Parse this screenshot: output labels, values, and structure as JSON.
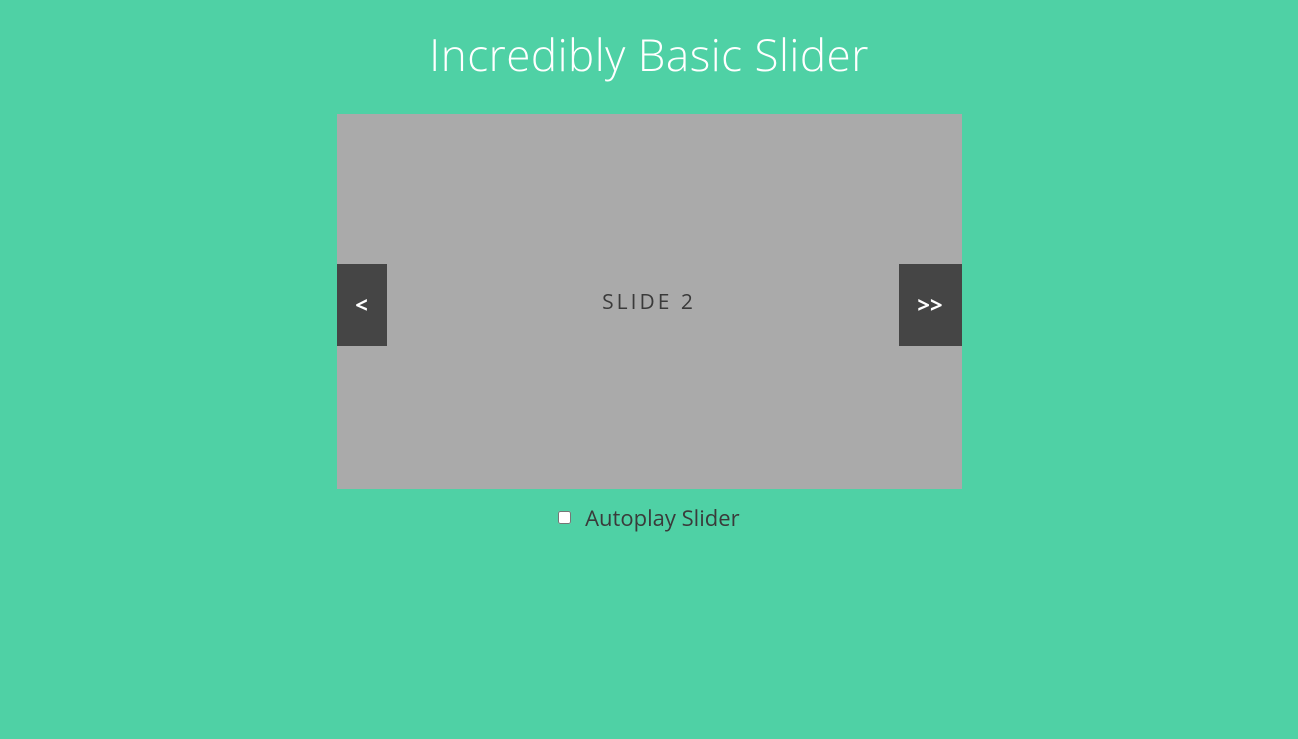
{
  "page": {
    "title": "Incredibly Basic Slider"
  },
  "slider": {
    "current_slide_label": "SLIDE 2",
    "prev_label": "<",
    "next_label": ">>"
  },
  "autoplay": {
    "label": "Autoplay Slider",
    "checked": false
  },
  "colors": {
    "background": "#4fd1a5",
    "slide_bg": "#aaaaaa",
    "arrow_bg": "#3a3a3a",
    "arrow_fg": "#ffffff",
    "title_fg": "#ffffff",
    "text_fg": "#3a3a3a"
  }
}
